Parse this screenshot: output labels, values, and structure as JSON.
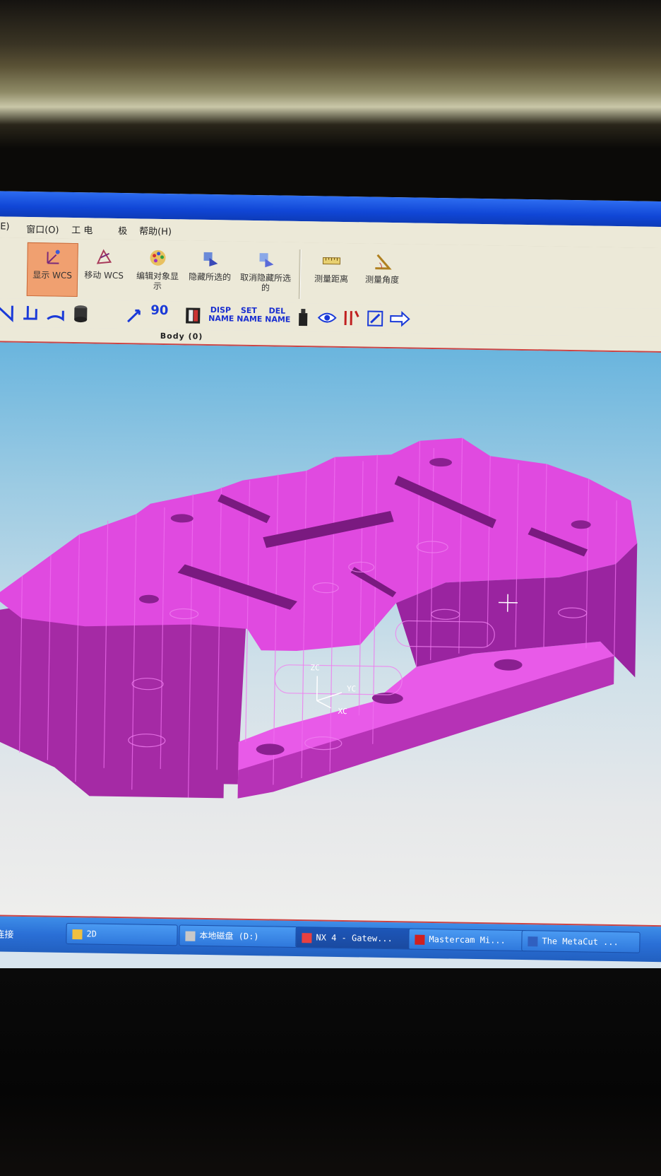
{
  "menubar": {
    "items": [
      "(E)",
      "窗口(O)",
      "工 电",
      "极",
      "帮助(H)"
    ]
  },
  "toolbar": {
    "buttons": [
      "显示 WCS",
      "移动 WCS",
      "编辑对象显示",
      "隐藏所选的",
      "取消隐藏所选的",
      "测量距离",
      "测量角度"
    ],
    "text_buttons": [
      "DISP NAME",
      "SET NAME",
      "DEL NAME"
    ],
    "rotate_label": "90"
  },
  "status": {
    "selection": "Body (0)"
  },
  "viewport": {
    "wcs_labels": {
      "zc": "ZC",
      "yc": "YC",
      "xc": "XC"
    },
    "part_color": "#d93fd9",
    "background_top": "#6ab5de",
    "background_bottom": "#eeeeec"
  },
  "taskbar": {
    "left_label": "网络连接",
    "tasks": [
      "2D",
      "本地磁盘 (D:)",
      "NX 4 - Gatew...",
      "Mastercam Mi...",
      "The MetaCut ..."
    ],
    "active_index": 2
  }
}
